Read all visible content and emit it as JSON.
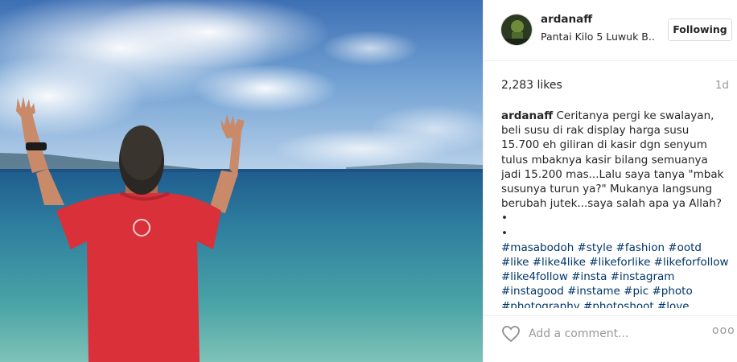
{
  "post": {
    "image_alt": "Man in red t-shirt raising hands facing the sea"
  },
  "header": {
    "username": "ardanaff",
    "location": "Pantai Kilo 5 Luwuk B..",
    "follow_label": "Following"
  },
  "stats": {
    "likes": "2,283 likes",
    "time": "1d"
  },
  "caption": {
    "username": "ardanaff",
    "lines": [
      "Ceritanya pergi ke swalayan,",
      "beli susu di rak display harga susu",
      "15.700 eh giliran di kasir dgn senyum",
      "tulus mbaknya kasir bilang semuanya",
      "jadi 15.200 mas...Lalu saya tanya \"mbak",
      "susunya turun ya?\" Mukanya langsung",
      "berubah jutek...saya salah apa ya Allah?"
    ],
    "bullets": [
      "•",
      "•"
    ],
    "hashtag_lines": [
      "#masabodoh #style #fashion #ootd",
      "#like #like4like #likeforlike #likeforfollow",
      "#like4follow #insta #instagram",
      "#instagood #instame #pic #photo",
      "#photography #photoshoot #love"
    ]
  },
  "footer": {
    "comment_placeholder": "Add a comment...",
    "more_label": "ooo",
    "heart_icon": "heart-outline-icon"
  },
  "colors": {
    "hashtag": "#003569",
    "muted": "#999999",
    "border": "#efefef"
  }
}
